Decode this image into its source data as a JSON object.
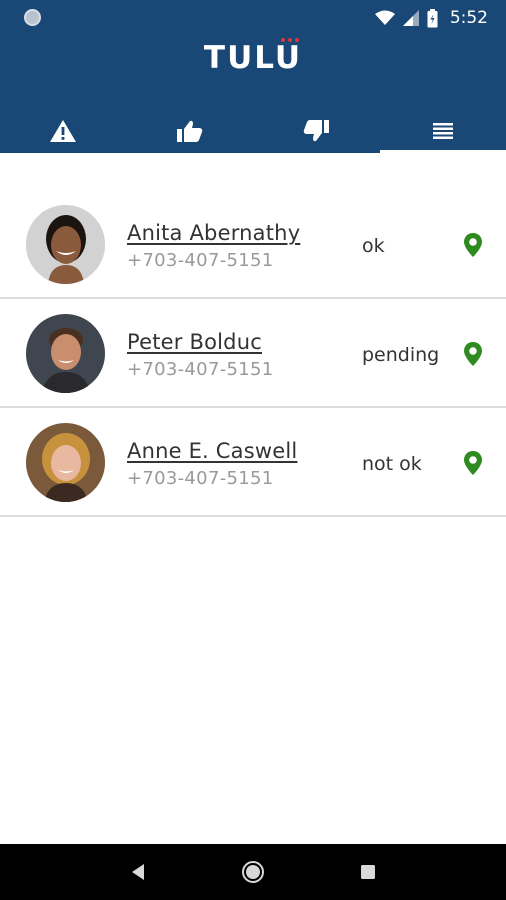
{
  "status_bar": {
    "time": "5:52"
  },
  "app": {
    "logo": "TULU",
    "brand_color": "#1a4876",
    "accent_dots_color": "#d9383a"
  },
  "tabs": [
    {
      "icon": "warning-icon",
      "active": false
    },
    {
      "icon": "thumbs-up-icon",
      "active": false
    },
    {
      "icon": "thumbs-down-icon",
      "active": false
    },
    {
      "icon": "list-icon",
      "active": true
    }
  ],
  "contacts": [
    {
      "name": "Anita Abernathy",
      "phone": "+703-407-5151",
      "status": "ok",
      "pin_icon": "location-pin-icon",
      "pin_color": "#2e8b1f"
    },
    {
      "name": "Peter Bolduc",
      "phone": "+703-407-5151",
      "status": "pending",
      "pin_icon": "location-pin-icon",
      "pin_color": "#2e8b1f"
    },
    {
      "name": "Anne E. Caswell",
      "phone": "+703-407-5151",
      "status": "not ok",
      "pin_icon": "location-pin-icon",
      "pin_color": "#2e8b1f"
    }
  ],
  "nav_bar": {
    "back": "back-icon",
    "home": "home-icon",
    "recents": "recents-icon"
  }
}
